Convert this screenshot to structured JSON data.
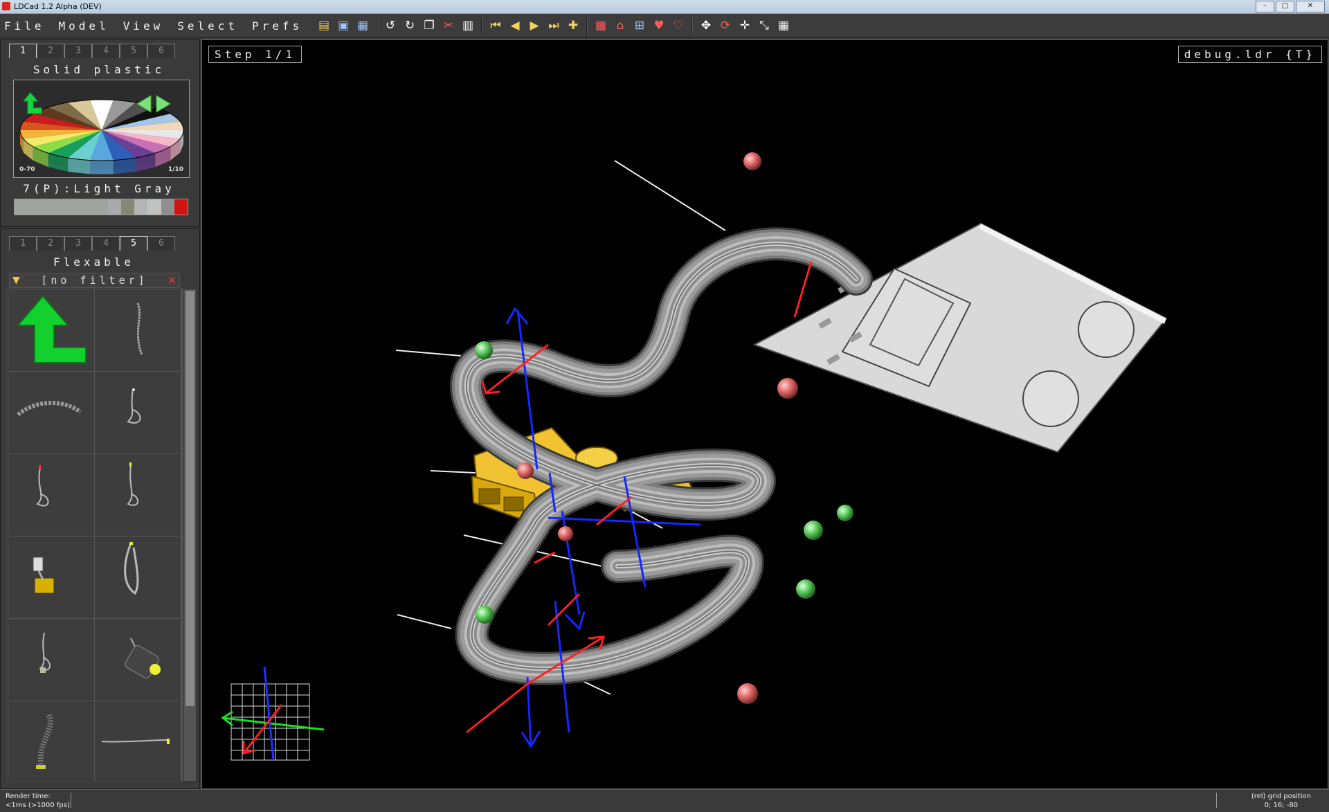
{
  "window": {
    "title": "LDCad 1.2 Alpha (DEV)",
    "buttons": {
      "minimize": "–",
      "maximize": "□",
      "close": "✕"
    }
  },
  "menu": [
    "File",
    "Model",
    "View",
    "Select",
    "Prefs"
  ],
  "toolbar": {
    "icons": [
      "open-icon",
      "save-icon",
      "save-all-icon",
      "undo-icon",
      "redo-icon",
      "copy-icon",
      "cut-icon",
      "paste-icon",
      "first-step-icon",
      "prev-step-icon",
      "next-step-icon",
      "last-step-icon",
      "add-step-icon",
      "model-icon",
      "home-icon",
      "rotate-origin-icon",
      "heart-icon",
      "heart-break-icon",
      "move-icon",
      "rotate-icon",
      "pan-icon",
      "zoom-fit-icon",
      "grid-icon"
    ]
  },
  "color_panel": {
    "tabs": [
      "1",
      "2",
      "3",
      "4",
      "5",
      "6"
    ],
    "active_tab": "1",
    "group_title": "Solid plastic",
    "range_label": "0-70",
    "page_label": "1/10",
    "selected_color": "7(P):Light Gray",
    "wheel_colors": [
      "#e8e8e8",
      "#f7b7c9",
      "#c770b4",
      "#6a3f96",
      "#2d60b8",
      "#5aa7e0",
      "#6dd0d0",
      "#17a05d",
      "#8edc46",
      "#f6ea6a",
      "#f4b23a",
      "#d9541e",
      "#c91d1d",
      "#5e3a1e",
      "#7f6a4a",
      "#d9c89a",
      "#ffffff",
      "#9a9a9a",
      "#505050",
      "#111111",
      "#a5c6e8",
      "#f3d7b4"
    ],
    "swatches": [
      "#9fa39f",
      "#a8aba8",
      "#858875",
      "#b3b6b3",
      "#c0c3c0",
      "#8f8f8f",
      "#d01414"
    ]
  },
  "parts_panel": {
    "tabs": [
      "1",
      "2",
      "3",
      "4",
      "5",
      "6"
    ],
    "active_tab": "5",
    "group_title": "Flexable",
    "filter_text": "[no filter]"
  },
  "viewport": {
    "step_label": "Step 1/1",
    "file_label": "debug.ldr {T}"
  },
  "status": {
    "render_label": "Render time:",
    "render_value": "<1ms (>1000 fps)",
    "grid_label": "(rel) grid position",
    "grid_value": "0; 16; -80"
  }
}
